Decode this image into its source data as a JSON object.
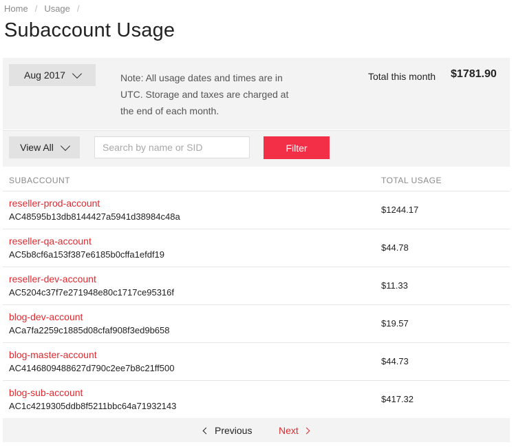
{
  "breadcrumb": {
    "home": "Home",
    "current": "Usage",
    "separator": "/"
  },
  "page_title": "Subaccount Usage",
  "summary": {
    "month_selected": "Aug 2017",
    "note": "Note: All usage dates and times are in UTC. Storage and taxes are charged at the end of each month.",
    "total_label": "Total this month",
    "total_value": "$1781.90"
  },
  "filter": {
    "view_selected": "View All",
    "search_placeholder": "Search by name or SID",
    "filter_label": "Filter"
  },
  "table": {
    "columns": [
      "SUBACCOUNT",
      "TOTAL USAGE"
    ],
    "rows": [
      {
        "name": "reseller-prod-account",
        "sid": "AC48595b13db8144427a5941d38984c48a",
        "total": "$1244.17"
      },
      {
        "name": "reseller-qa-account",
        "sid": "AC5b8cf6a153f387e6185b0cffa1efdf19",
        "total": "$44.78"
      },
      {
        "name": "reseller-dev-account",
        "sid": "AC5204c37f7e271948e80c1717ce95316f",
        "total": "$11.33"
      },
      {
        "name": "blog-dev-account",
        "sid": "ACa7fa2259c1885d08cfaf908f3ed9b658",
        "total": "$19.57"
      },
      {
        "name": "blog-master-account",
        "sid": "AC4146809488627d790c2ee7b8c21ff500",
        "total": "$44.73"
      },
      {
        "name": "blog-sub-account",
        "sid": "AC1c4219305ddb8f5211bbc64a71932143",
        "total": "$417.32"
      }
    ]
  },
  "pagination": {
    "previous": "Previous",
    "next": "Next"
  },
  "colors": {
    "accent": "#f22f46",
    "link": "#e0282e",
    "panel": "#f3f3f3",
    "control": "#e2e2e2"
  }
}
